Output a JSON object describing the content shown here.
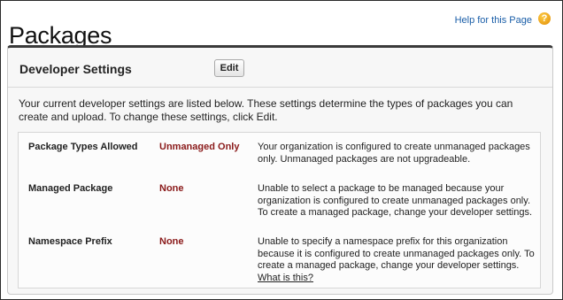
{
  "header": {
    "title": "Packages",
    "help_link": "Help for this Page",
    "help_icon": "?"
  },
  "panel": {
    "title": "Developer Settings",
    "edit_label": "Edit",
    "intro": "Your current developer settings are listed below. These settings determine the types of packages you can create and upload. To change these settings, click Edit."
  },
  "settings": [
    {
      "label": "Package Types Allowed",
      "value": "Unmanaged Only",
      "description": "Your organization is configured to create unmanaged packages only. Unmanaged packages are not upgradeable."
    },
    {
      "label": "Managed Package",
      "value": "None",
      "description": "Unable to select a package to be managed because your organization is configured to create unmanaged packages only. To create a managed package, change your developer settings."
    },
    {
      "label": "Namespace Prefix",
      "value": "None",
      "description": "Unable to specify a namespace prefix for this organization because it is configured to create unmanaged packages only. To create a managed package, change your developer settings. ",
      "link": "What is this?"
    }
  ],
  "colors": {
    "value_text": "#8a1a1a",
    "link": "#1a5ea8",
    "panel_border_top": "#3a3a3a",
    "help_icon": "#e08a00"
  }
}
